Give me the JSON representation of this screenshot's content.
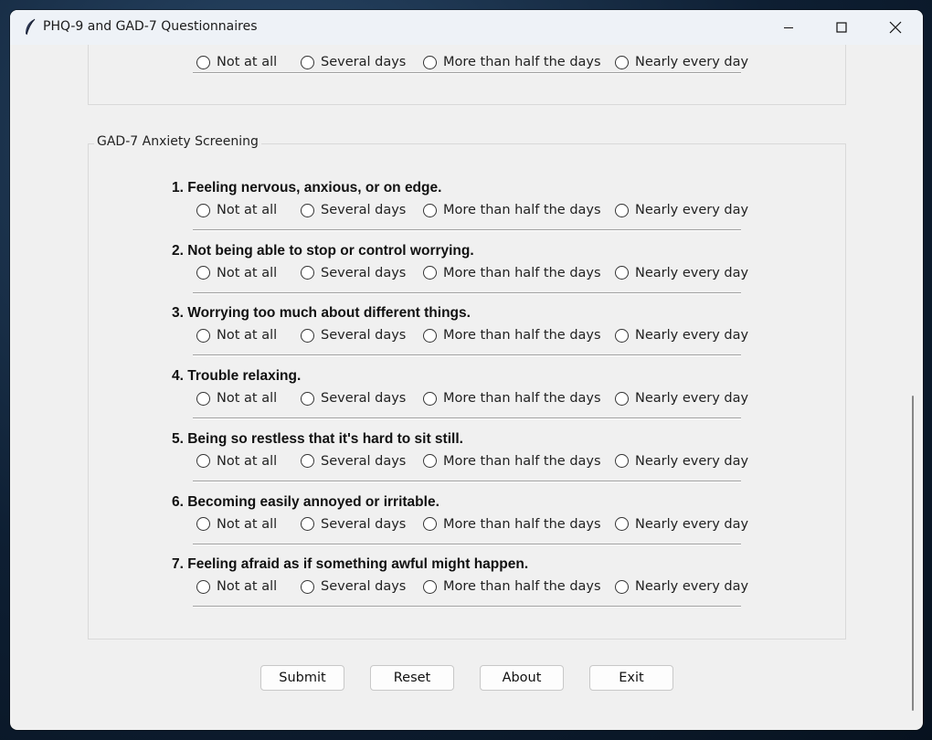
{
  "window": {
    "title": "PHQ-9 and GAD-7 Questionnaires"
  },
  "options": [
    "Not at all",
    "Several days",
    "More than half the days",
    "Nearly every day"
  ],
  "gad7": {
    "section_label": "GAD-7 Anxiety Screening",
    "questions": [
      "1. Feeling nervous, anxious, or on edge.",
      "2. Not being able to stop or control worrying.",
      "3. Worrying too much about different things.",
      "4. Trouble relaxing.",
      "5. Being so restless that it's hard to sit still.",
      "6. Becoming easily annoyed or irritable.",
      "7. Feeling afraid as if something awful might happen."
    ]
  },
  "buttons": {
    "submit": "Submit",
    "reset": "Reset",
    "about": "About",
    "exit": "Exit"
  },
  "icons": {
    "app": "feather-icon",
    "minimize": "minimize-icon",
    "maximize": "maximize-icon",
    "close": "close-icon"
  }
}
